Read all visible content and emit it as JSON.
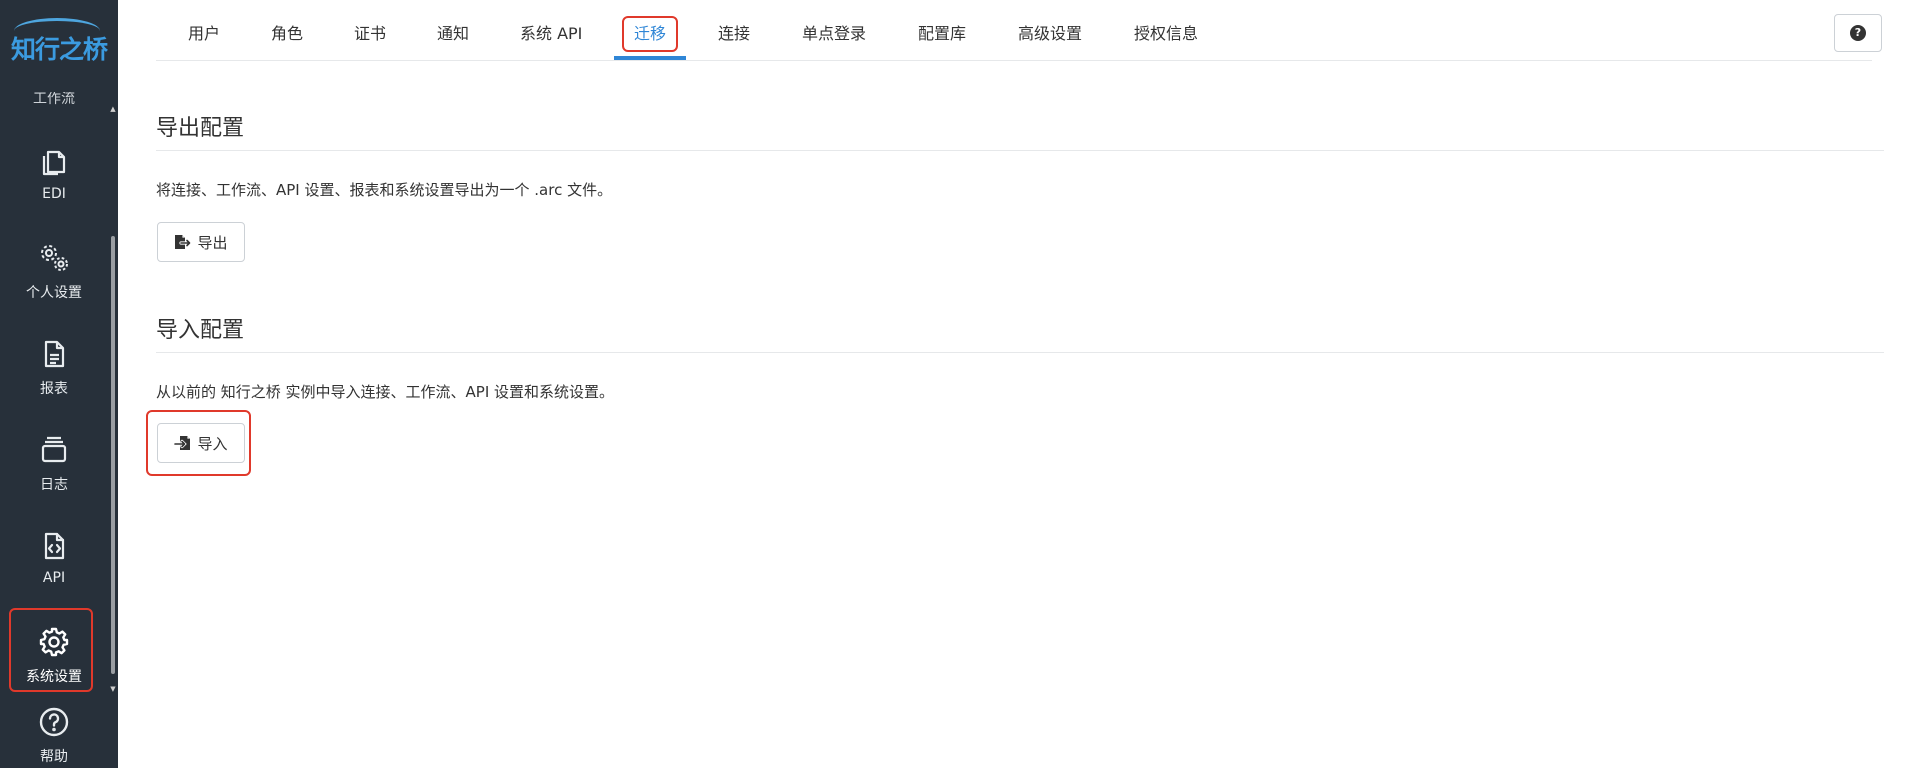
{
  "brand": {
    "logo_text": "知行之桥",
    "accent": "#2f86d6",
    "highlight": "#e0392b"
  },
  "sidebar": {
    "partial_item": "工作流",
    "items": [
      {
        "label": "EDI",
        "icon": "copy-icon"
      },
      {
        "label": "个人设置",
        "icon": "gears-icon"
      },
      {
        "label": "报表",
        "icon": "report-icon"
      },
      {
        "label": "日志",
        "icon": "logs-icon"
      },
      {
        "label": "API",
        "icon": "api-icon"
      },
      {
        "label": "系统设置",
        "icon": "gear-icon",
        "active": true
      },
      {
        "label": "帮助",
        "icon": "question-icon"
      }
    ]
  },
  "tabs": [
    {
      "label": "用户"
    },
    {
      "label": "角色"
    },
    {
      "label": "证书"
    },
    {
      "label": "通知"
    },
    {
      "label": "系统 API"
    },
    {
      "label": "迁移",
      "active": true
    },
    {
      "label": "连接"
    },
    {
      "label": "单点登录"
    },
    {
      "label": "配置库"
    },
    {
      "label": "高级设置"
    },
    {
      "label": "授权信息"
    }
  ],
  "help": {
    "icon": "question-circle-icon",
    "glyph": "?"
  },
  "export_section": {
    "title": "导出配置",
    "description": "将连接、工作流、API 设置、报表和系统设置导出为一个 .arc 文件。",
    "button_label": "导出"
  },
  "import_section": {
    "title": "导入配置",
    "description": "从以前的 知行之桥 实例中导入连接、工作流、API 设置和系统设置。",
    "button_label": "导入"
  }
}
